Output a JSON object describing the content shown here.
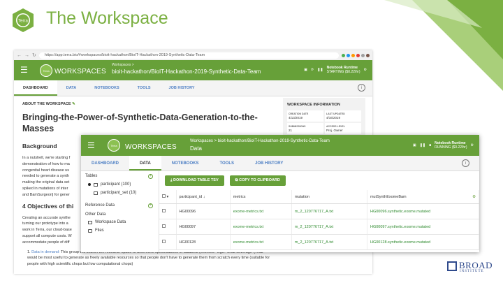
{
  "slide": {
    "title": "The Workspace"
  },
  "browser": {
    "url": "https://app.terra.bio/#workspaces/bioit-hackathon/BioIT-Hackathon-2019-Synthetic-Data-Team"
  },
  "win1": {
    "logo": "Terra",
    "brand": "WORKSPACES",
    "crumb": "Workspaces >",
    "workspace": "bioit-hackathon/BioIT-Hackathon-2019-Synthetic-Data-Team",
    "runtime_label": "Notebook Runtime",
    "runtime_status": "STARTING ($0.22/hr)",
    "tabs": [
      "DASHBOARD",
      "DATA",
      "NOTEBOOKS",
      "TOOLS",
      "JOB HISTORY"
    ],
    "about": "ABOUT THE WORKSPACE",
    "title": "Bringing-the-Power-of-Synthetic-Data-Generation-to-the-Masses",
    "bg_heading": "Background",
    "bg_text": "In a nutshell, we're starting f... demonstration of how to ma... congenital heart disease us... needed to generate a synthe... making the original data set... spiked in mutations of intere... and BamSurgeon] for gener...",
    "bg_line1": "In a nutshell, we're starting f",
    "bg_line2": "demonstration of how to ma",
    "bg_line3": "congenital heart disease us",
    "bg_line4": "needed to generate a synth",
    "bg_line5": "making the original data set",
    "bg_line6": "spiked in mutations of inter",
    "bg_line7": "and BamSurgeon] for gener",
    "obj_heading": "4 Objectives of thi",
    "obj_line1": "Creating an accurate synthe",
    "obj_line2": "turning our prototype into a",
    "obj_line3": "work in Terra, our cloud-base",
    "obj_line4": "support all compute costs. W",
    "obj_line5": "accommodate people of diff",
    "list_num": "1.",
    "list_link": "Data in demand:",
    "list_text": " This group will search the research space to determine specifications of datasets (exomes? wgs? what coverage?) that would be most useful to generate as freely available resources so that people don't have to generate them from scratch every time (suitable for people with high scientific chops but low computational chops)",
    "info_title": "WORKSPACE INFORMATION",
    "info": [
      {
        "k": "CREATION DATE",
        "v": "4/13/2019"
      },
      {
        "k": "LAST UPDATED",
        "v": "4/16/2019"
      },
      {
        "k": "SUBMISSIONS",
        "v": "21"
      },
      {
        "k": "ACCESS LEVEL",
        "v": "Proj. Owner"
      }
    ]
  },
  "win2": {
    "logo": "Terra",
    "brand": "WORKSPACES",
    "crumb": "Workspaces > bioit-hackathon/BioIT-Hackathon-2019-Synthetic-Data-Team",
    "page": "Data",
    "runtime_label": "Notebook Runtime",
    "runtime_status": "RUNNING ($0.22/hr)",
    "tabs": [
      "DASHBOARD",
      "DATA",
      "NOTEBOOKS",
      "TOOLS",
      "JOB HISTORY"
    ],
    "tables_label": "Tables",
    "tables": [
      "participant (100)",
      "participant_set (10)"
    ],
    "ref_label": "Reference Data",
    "other_label": "Other Data",
    "other": [
      "Workspace Data",
      "Files"
    ],
    "download_btn": "DOWNLOAD TABLE TSV",
    "copy_btn": "COPY TO CLIPBOARD",
    "columns": [
      "participant_id",
      "metrics",
      "mutation",
      "mutSynthExomeBam"
    ],
    "rows": [
      [
        "HG00096",
        "exome-metrics.txt",
        "m_2_120776717_A.txt",
        "HG00096.synthetic.exome.mutated"
      ],
      [
        "HG00097",
        "exome-metrics.txt",
        "m_2_120776717_A.txt",
        "HG00097.synthetic.exome.mutated"
      ],
      [
        "HG00128",
        "exome-metrics.txt",
        "m_2_120776717_A.txt",
        "HG00128.synthetic.exome.mutated"
      ]
    ]
  },
  "footer": {
    "brand": "BROAD",
    "sub": "INSTITUTE"
  }
}
